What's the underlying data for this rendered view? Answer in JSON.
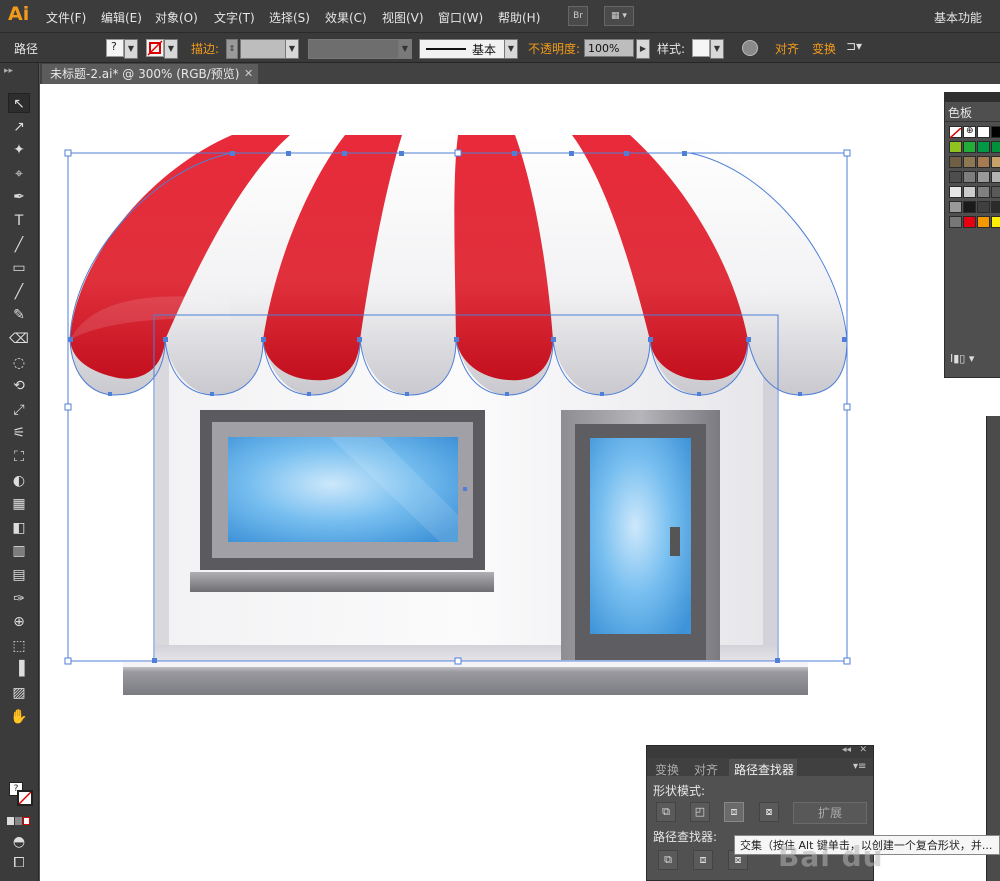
{
  "app": {
    "logo": "Ai",
    "workspace": "基本功能"
  },
  "menu": [
    "文件(F)",
    "编辑(E)",
    "对象(O)",
    "文字(T)",
    "选择(S)",
    "效果(C)",
    "视图(V)",
    "窗口(W)",
    "帮助(H)"
  ],
  "menu_buttons": {
    "bridge": "Br",
    "arrange": "▦ ▾"
  },
  "control": {
    "selection_type": "路径",
    "stroke_label": "描边:",
    "stroke_style": "基本",
    "opacity_label": "不透明度:",
    "opacity_value": "100%",
    "style_label": "样式:",
    "align_label": "对齐",
    "transform_label": "变换"
  },
  "document": {
    "tab": "未标题-2.ai* @ 300% (RGB/预览)",
    "close": "✕"
  },
  "tools": [
    "↖",
    "↗",
    "✦",
    "⌖",
    "✒",
    "T",
    "╱",
    "▭",
    "╱",
    "✎",
    "⌫",
    "◌",
    "⟲",
    "⤢",
    "⚟",
    "⛶",
    "◐",
    "▦",
    "◧",
    "▥",
    "▤",
    "✑",
    "⊕",
    "⬚",
    "▐",
    "▨",
    "✋",
    "⚲"
  ],
  "swatches_panel": {
    "title": "色板",
    "colors": [
      "#ffffff",
      "#1a1a1a",
      "#e60012",
      "#f7e100",
      "#00a0e9",
      "#009944",
      "#8fc31f",
      "#22ac38",
      "#009e96",
      "#0068b7",
      "#1d2088",
      "#920783",
      "#6e5f45",
      "#a57c52",
      "#c4a26a",
      "#d6b684",
      "#7a6a50",
      "#4d3d28",
      "#999999",
      "#b3b3b3",
      "#cccccc",
      "#e6e6e6",
      "#808080",
      "#666666",
      "#f2f2f2",
      "#1a1a1a",
      "#333333",
      "#4d4d4d",
      "#595959",
      "#404040",
      "#2b2b2b",
      "#e95513",
      "#f39800",
      "#fff100",
      "#8fc31f",
      "#00a0e9"
    ],
    "footer": "I▮▯ ▾"
  },
  "pathfinder_panel": {
    "tabs": [
      "变换",
      "对齐",
      "路径查找器"
    ],
    "shape_modes_label": "形状模式:",
    "pathfinders_label": "路径查找器:",
    "expand_label": "扩展",
    "tooltip": "交集（按住 Alt 键单击，以创建一个复合形状，并..."
  },
  "watermark": "Bai du"
}
